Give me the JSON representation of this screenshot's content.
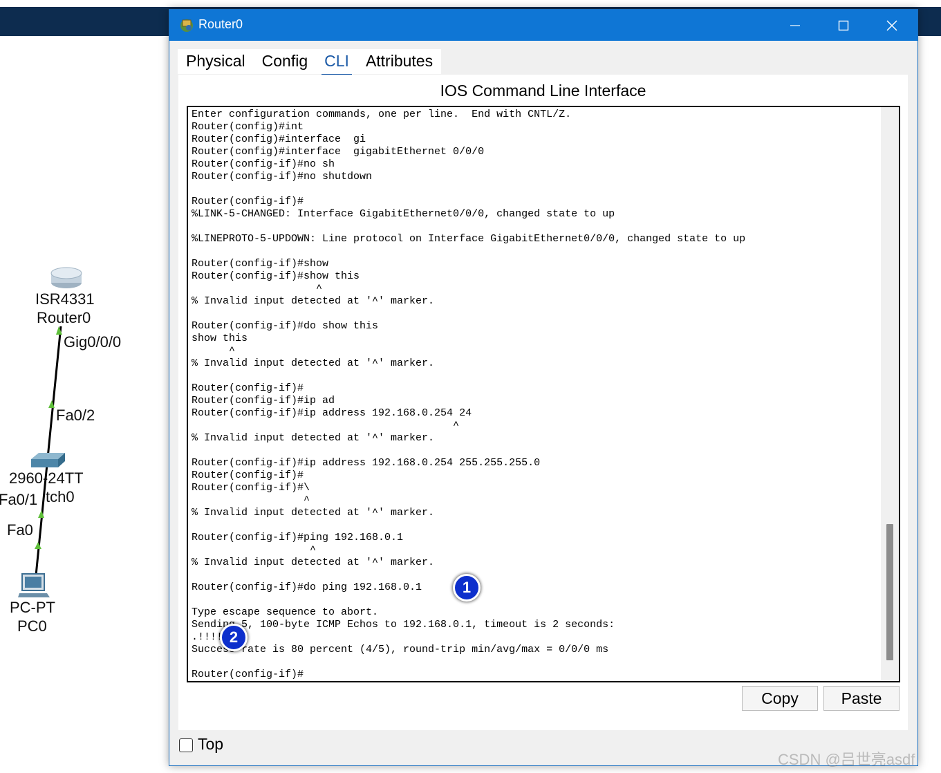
{
  "workspace": {
    "router_model": "ISR4331",
    "router_name": "Router0",
    "router_port": "Gig0/0/0",
    "switch_up_port": "Fa0/2",
    "switch_model": "2960-24TT",
    "switch_name_visible": "tch0",
    "switch_down_port": "Fa0/1",
    "pc_port": "Fa0",
    "pc_model": "PC-PT",
    "pc_name": "PC0"
  },
  "window": {
    "title": "Router0",
    "tabs": [
      {
        "label": "Physical",
        "active": false
      },
      {
        "label": "Config",
        "active": false
      },
      {
        "label": "CLI",
        "active": true
      },
      {
        "label": "Attributes",
        "active": false
      }
    ],
    "heading": "IOS Command Line Interface",
    "cli_lines": [
      "Enter configuration commands, one per line.  End with CNTL/Z.",
      "Router(config)#int",
      "Router(config)#interface  gi",
      "Router(config)#interface  gigabitEthernet 0/0/0",
      "Router(config-if)#no sh",
      "Router(config-if)#no shutdown",
      "",
      "Router(config-if)#",
      "%LINK-5-CHANGED: Interface GigabitEthernet0/0/0, changed state to up",
      "",
      "%LINEPROTO-5-UPDOWN: Line protocol on Interface GigabitEthernet0/0/0, changed state to up",
      "",
      "Router(config-if)#show",
      "Router(config-if)#show this",
      "                    ^",
      "% Invalid input detected at '^' marker.",
      "",
      "Router(config-if)#do show this",
      "show this",
      "      ^",
      "% Invalid input detected at '^' marker.",
      "",
      "Router(config-if)#",
      "Router(config-if)#ip ad",
      "Router(config-if)#ip address 192.168.0.254 24",
      "                                          ^",
      "% Invalid input detected at '^' marker.",
      "",
      "Router(config-if)#ip address 192.168.0.254 255.255.255.0",
      "Router(config-if)#",
      "Router(config-if)#\\",
      "                  ^",
      "% Invalid input detected at '^' marker.",
      "",
      "Router(config-if)#ping 192.168.0.1",
      "                   ^",
      "% Invalid input detected at '^' marker.",
      "",
      "Router(config-if)#do ping 192.168.0.1",
      "",
      "Type escape sequence to abort.",
      "Sending 5, 100-byte ICMP Echos to 192.168.0.1, timeout is 2 seconds:",
      ".!!!!",
      "Success rate is 80 percent (4/5), round-trip min/avg/max = 0/0/0 ms",
      "",
      "Router(config-if)#"
    ],
    "copy_label": "Copy",
    "paste_label": "Paste",
    "top_label": "Top",
    "top_checked": false
  },
  "annotations": {
    "marker1": "1",
    "marker2": "2"
  },
  "watermark": "CSDN @吕世亮asdf",
  "colors": {
    "titlebar": "#0f76d5",
    "topbar": "#0d2c4f",
    "active_tab": "#1b5aa7",
    "marker": "#0d2fcc"
  }
}
